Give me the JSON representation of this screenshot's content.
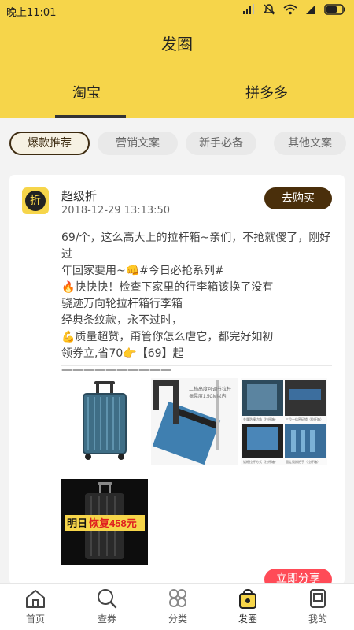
{
  "status_bar": {
    "time": "晚上11:01",
    "battery_color": "#222222"
  },
  "header": {
    "title": "发圈",
    "background_color": "#f6d54a",
    "tabs": [
      {
        "label": "淘宝",
        "active": true
      },
      {
        "label": "拼多多",
        "active": false
      }
    ]
  },
  "filters": [
    {
      "label": "爆款推荐",
      "active": true
    },
    {
      "label": "营销文案",
      "active": false
    },
    {
      "label": "新手必备",
      "active": false
    },
    {
      "label": "其他文案",
      "active": false
    }
  ],
  "post": {
    "avatar_glyph": "折",
    "author": "超级折",
    "date": "2018-12-29 13:13:50",
    "buy_button": "去购买",
    "lines": [
      "69/个，这么高大上的拉杆箱~亲们，不抢就傻了，刚好过",
      "年回家要用~👊#今日必抢系列#",
      "🔥快快快！检查下家里的行李箱该换了没有",
      "骁迹万向轮拉杆箱行李箱",
      "经典条纹款，永不过时，",
      "💪质量超赞，甭管你怎么虐它，都完好如初",
      "领券立,省70👉【69】起",
      "——————————"
    ],
    "images": [
      {
        "name": "blue-suitcase-photo"
      },
      {
        "name": "suitcase-handle-detail-photo",
        "caption": "二档高度可调节拉杆 振晃度1.5CM以内"
      },
      {
        "name": "suitcase-features-collage",
        "labels": [
          "金属防撞边角（拉杆箱）",
          "三位一体密码锁（拉杆箱）",
          "铝框拉杆方式（拉杆箱）",
          "固定锁扣把手（拉杆箱）"
        ]
      },
      {
        "name": "black-suitcase-promo-photo",
        "banner_left": "明日",
        "banner_right": "恢复458元"
      }
    ],
    "share_button": "立即分享"
  },
  "bottom_nav": [
    {
      "label": "首页",
      "icon": "home-icon",
      "active": false
    },
    {
      "label": "查券",
      "icon": "search-icon",
      "active": false
    },
    {
      "label": "分类",
      "icon": "category-icon",
      "active": false
    },
    {
      "label": "发圈",
      "icon": "share-bag-icon",
      "active": true
    },
    {
      "label": "我的",
      "icon": "profile-icon",
      "active": false
    }
  ]
}
